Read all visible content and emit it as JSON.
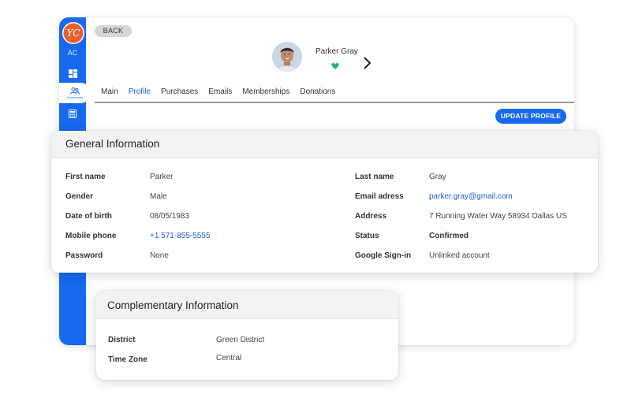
{
  "sidebar": {
    "logo_text": "YC",
    "initials": "AC",
    "active_item_label": "Community",
    "icons": [
      "dashboard-icon",
      "community-icon",
      "calculator-icon"
    ],
    "accent": "#1769f0"
  },
  "header": {
    "back_label": "BACK",
    "profile_name": "Parker Gray",
    "heart_color": "#19b38c"
  },
  "tabs": [
    {
      "label": "Main",
      "active": false
    },
    {
      "label": "Profile",
      "active": true
    },
    {
      "label": "Purchases",
      "active": false
    },
    {
      "label": "Emails",
      "active": false
    },
    {
      "label": "Memberships",
      "active": false
    },
    {
      "label": "Donations",
      "active": false
    }
  ],
  "actions": {
    "update_profile_label": "UPDATE PROFILE"
  },
  "general_info": {
    "title": "General Information",
    "left_fields": [
      {
        "label": "First name",
        "value": "Parker"
      },
      {
        "label": "Gender",
        "value": "Male"
      },
      {
        "label": "Date of birth",
        "value": "08/05/1983"
      },
      {
        "label": "Mobile phone",
        "value": "+1 571-855-5555"
      },
      {
        "label": "Password",
        "value": "None"
      }
    ],
    "right_fields": [
      {
        "label": "Last name",
        "value": "Gray"
      },
      {
        "label": "Email adress",
        "value": "parker.gray@gmail.com"
      },
      {
        "label": "Address",
        "value": "7 Running Water Way 58934 Dallas US"
      },
      {
        "label": "Status",
        "value": "Confirmed"
      },
      {
        "label": "Google Sign-in",
        "value": "Unlinked account"
      }
    ]
  },
  "complementary_info": {
    "title": "Complementary Information",
    "fields": [
      {
        "label": "District",
        "value": "Green District"
      },
      {
        "label": "Time Zone",
        "value": "Central"
      }
    ]
  }
}
